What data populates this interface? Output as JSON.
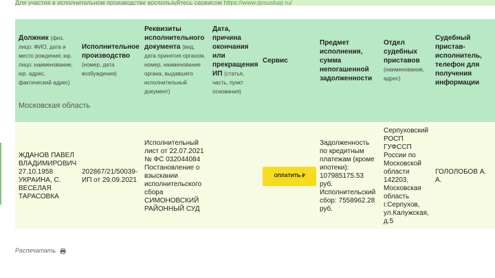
{
  "top_note": {
    "text": "Для участия в исполнительном производстве воспользуйтесь сервисом",
    "link": "https://www.gosuslugi.ru/"
  },
  "table": {
    "headers": {
      "debtor": {
        "title": "Должник",
        "sub": "(физ. лицо: ФИО, дата и место рождения; юр. лицо: наименование, юр. адрес, фактический адрес)"
      },
      "proceeding": {
        "title": "Исполнительное производство",
        "sub": "(номер, дата возбуждения)"
      },
      "document": {
        "title": "Реквизиты исполнительного документа",
        "sub": "(вид, дата принятия органом, номер, наименование органа, выдавшего исполнительный документ)"
      },
      "end": {
        "title": "Дата, причина окончания или прекращения ИП",
        "sub": "(статья, часть, пункт основания)"
      },
      "service": {
        "title": "Сервис"
      },
      "subject": {
        "title": "Предмет исполнения, сумма непогашенной задолженности"
      },
      "department": {
        "title": "Отдел судебных приставов",
        "sub": "(наименование, адрес)"
      },
      "bailiff": {
        "title": "Судебный пристав-исполнитель, телефон для получения информации"
      }
    },
    "region": "Московская область",
    "row": {
      "debtor": "ЖДАНОВ ПАВЕЛ ВЛАДИМИРОВИЧ 27.10.1958 УКРАИНА, С. ВЕСЕЛАЯ ТАРАСОВКА",
      "proceeding": "202867/21/50039-ИП от 29.09.2021",
      "document": "Исполнительный лист от 22.07.2021 № ФС 032044084 Постановление о взыскании исполнительского сбора СИМОНОВСКИЙ РАЙОННЫЙ СУД",
      "end": "",
      "pay_label": "ОПЛАТИТЬ ₽",
      "subject": "Задолженность по кредитным платежам (кроме ипотеки): 107985175.53 руб. Исполнительский сбор: 7558962.28 руб.",
      "department": "Серпуховский РОСП ГУФССП России по Московской области 142203, Московская область г.Серпухов, ул.Калужская, д.5",
      "bailiff": "ГОЛОЛОБОВ А. А."
    }
  },
  "print_label": "Распечатать",
  "icons": {
    "print": "printer-icon"
  },
  "colors": {
    "header_bg": "#b8e8c4",
    "row_bg": "#f7fbe2",
    "button": "#f6dc1e"
  }
}
